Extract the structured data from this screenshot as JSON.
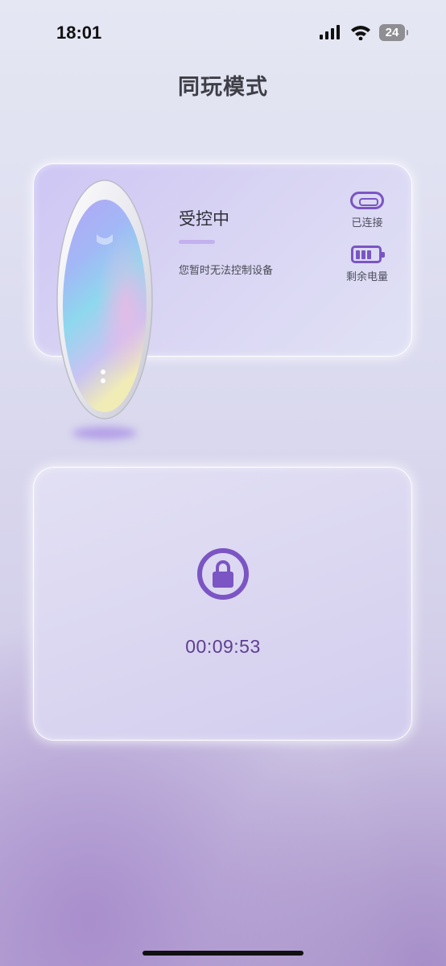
{
  "status_bar": {
    "time": "18:01",
    "battery_level": "24",
    "signal_icon": "cellular-signal-icon",
    "wifi_icon": "wifi-icon"
  },
  "page": {
    "title": "同玩模式"
  },
  "device_card": {
    "status_heading": "受控中",
    "status_description": "您暂时无法控制设备",
    "connection_label": "已连接",
    "battery_label": "剩余电量",
    "connection_icon": "usb-c-icon",
    "battery_icon": "battery-icon",
    "battery_level_fraction": 0.75
  },
  "control_card": {
    "lock_icon": "lock-icon",
    "timer": "00:09:53"
  },
  "colors": {
    "accent": "#7b55c3",
    "timer_text": "#5e3e90",
    "underline": "#c3b0ee"
  }
}
